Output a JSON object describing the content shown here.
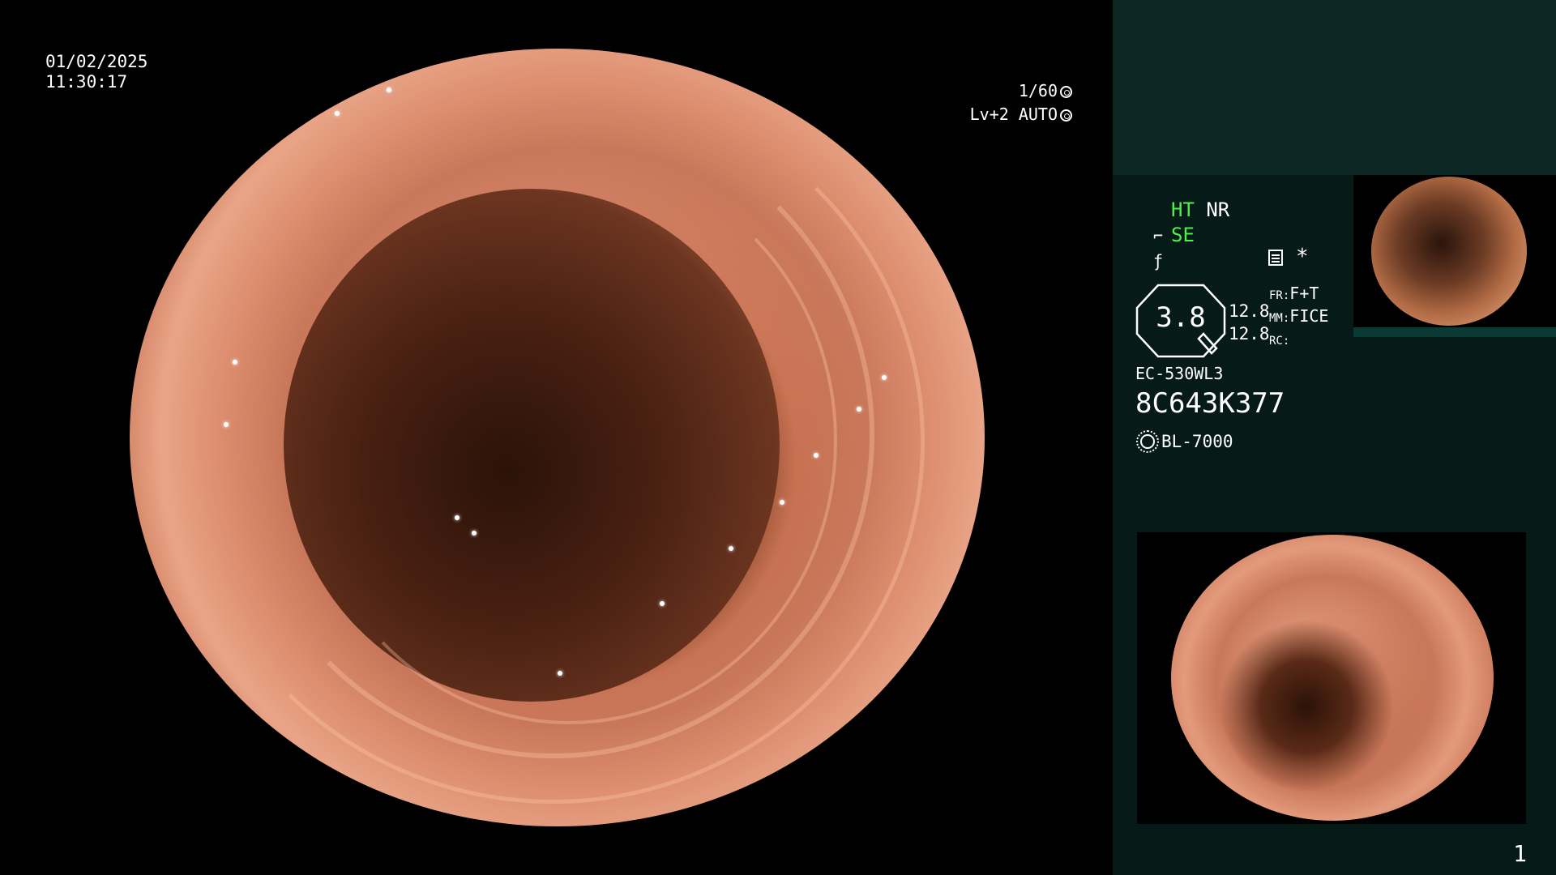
{
  "main_view": {
    "date": "01/02/2025",
    "time": "11:30:17",
    "shutter_speed": "1/60",
    "iris_level": "Lv+2 AUTO",
    "shutter_icon": "shutter-icon",
    "iris_icon": "iris-icon"
  },
  "panel": {
    "mode_ht": "HT",
    "mode_nr": "NR",
    "mode_se": "SE",
    "se_icon": "scope-tip-icon",
    "freeze_icon": "freeze-icon",
    "list_icon": "list-icon",
    "star": "*",
    "zoom_value": "3.8",
    "num_top": "12.8",
    "num_bottom": "12.8",
    "fr_label": "FR:",
    "fr_value": "F+T",
    "mm_label": "MM:",
    "mm_value": "FICE",
    "rc_label": "RC:",
    "scope_model": "EC-530WL3",
    "serial_number": "8C643K377",
    "light_source": "BL-7000",
    "light_icon": "light-source-icon",
    "page_number": "1"
  },
  "colors": {
    "panel_bg": "#061a17",
    "panel_top_bg": "#0d2724",
    "active_green": "#4ef04a"
  }
}
